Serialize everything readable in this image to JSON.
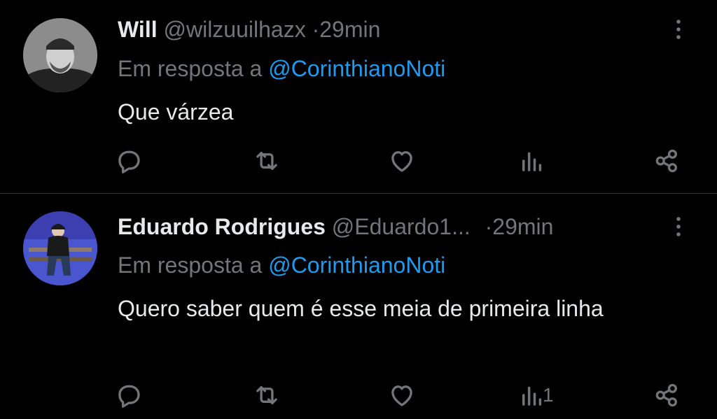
{
  "tweets": [
    {
      "name": "Will",
      "handle": "@wilzuuilhazx",
      "separator": "·",
      "time": "29min",
      "reply_prefix": "Em resposta a",
      "reply_mention": "@CorinthianoNoti",
      "text": "Que várzea",
      "views_count": ""
    },
    {
      "name": "Eduardo Rodrigues",
      "handle": "@Eduardo1...",
      "separator": "·",
      "time": "29min",
      "reply_prefix": "Em resposta a",
      "reply_mention": "@CorinthianoNoti",
      "text": "Quero saber quem é esse meia de primeira linha",
      "views_count": "1"
    }
  ],
  "icons": [
    "more-icon",
    "reply-icon",
    "retweet-icon",
    "like-icon",
    "views-icon",
    "share-icon"
  ],
  "colors": {
    "background": "#000000",
    "text": "#e7e9ea",
    "muted": "#71767b",
    "accent": "#1d9bf0",
    "divider": "#2f3336"
  }
}
